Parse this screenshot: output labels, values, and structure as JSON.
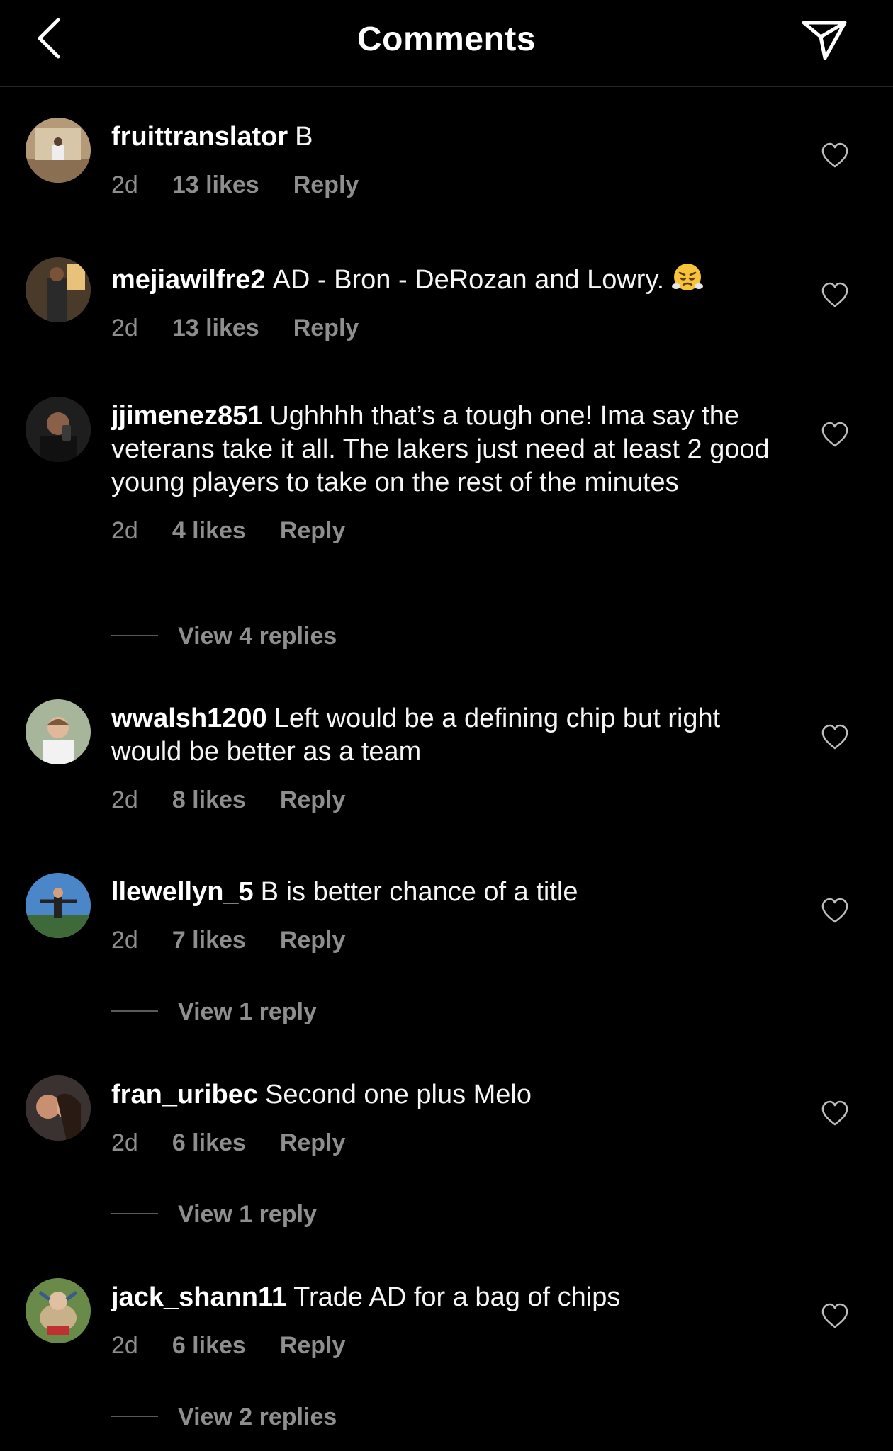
{
  "header": {
    "title": "Comments",
    "back_icon": "chevron-left-icon",
    "share_icon": "paper-plane-icon"
  },
  "comments": [
    {
      "username": "fruittranslator",
      "text": "B",
      "time": "2d",
      "likes": "13 likes",
      "reply": "Reply"
    },
    {
      "username": "mejiawilfre2",
      "text": "AD - Bron - DeRozan and Lowry.",
      "emoji": "face-with-steam-emoji",
      "time": "2d",
      "likes": "13 likes",
      "reply": "Reply"
    },
    {
      "username": "jjimenez851",
      "text": "Ughhhh that’s a tough one! Ima say the veterans take it all. The lakers just need at least 2 good young players to take on the rest of the minutes",
      "time": "2d",
      "likes": "4 likes",
      "reply": "Reply",
      "view_replies": "View 4 replies"
    },
    {
      "username": "wwalsh1200",
      "text": "Left would be a defining chip but right would be better as a team",
      "time": "2d",
      "likes": "8 likes",
      "reply": "Reply"
    },
    {
      "username": "llewellyn_5",
      "text": "B is better chance of a title",
      "time": "2d",
      "likes": "7 likes",
      "reply": "Reply",
      "view_replies": "View 1 reply"
    },
    {
      "username": "fran_uribec",
      "text": "Second one plus Melo",
      "time": "2d",
      "likes": "6 likes",
      "reply": "Reply",
      "view_replies": "View 1 reply"
    },
    {
      "username": "jack_shann11",
      "text": "Trade AD for a bag of chips",
      "time": "2d",
      "likes": "6 likes",
      "reply": "Reply",
      "view_replies": "View 2 replies"
    }
  ],
  "colors": {
    "background": "#000000",
    "primary_text": "#f5f5f5",
    "secondary_text": "#8e8e8e",
    "divider": "#262626"
  }
}
